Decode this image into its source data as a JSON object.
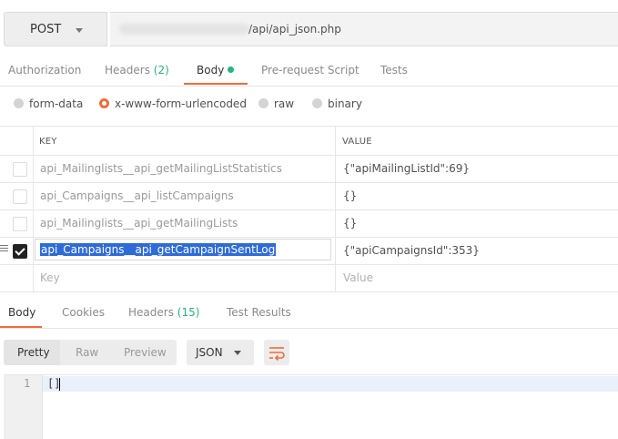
{
  "request": {
    "method": "POST",
    "url_visible": "/api/api_json.php"
  },
  "request_tabs": [
    {
      "label": "Authorization"
    },
    {
      "label": "Headers",
      "count": "(2)"
    },
    {
      "label": "Body",
      "active": true
    },
    {
      "label": "Pre-request Script"
    },
    {
      "label": "Tests"
    }
  ],
  "body_types": [
    {
      "label": "form-data",
      "selected": false
    },
    {
      "label": "x-www-form-urlencoded",
      "selected": true
    },
    {
      "label": "raw",
      "selected": false
    },
    {
      "label": "binary",
      "selected": false
    }
  ],
  "params_table": {
    "headers": {
      "key": "KEY",
      "value": "VALUE"
    },
    "rows": [
      {
        "key": "api_Mailinglists__api_getMailingListStatistics",
        "value": "{\"apiMailingListId\":69}",
        "checked": false
      },
      {
        "key": "api_Campaigns__api_listCampaigns",
        "value": "{}",
        "checked": false
      },
      {
        "key": "api_Mailinglists__api_getMailingLists",
        "value": "{}",
        "checked": false
      },
      {
        "key": "api_Campaigns__api_getCampaignSentLog",
        "value": "{\"apiCampaignsId\":353}",
        "checked": true
      }
    ],
    "new_row": {
      "key_placeholder": "Key",
      "value_placeholder": "Value"
    }
  },
  "response_tabs": [
    {
      "label": "Body",
      "active": true
    },
    {
      "label": "Cookies"
    },
    {
      "label": "Headers",
      "count": "(15)"
    },
    {
      "label": "Test Results"
    }
  ],
  "response_view": {
    "modes": [
      "Pretty",
      "Raw",
      "Preview"
    ],
    "active_mode": "Pretty",
    "format": "JSON"
  },
  "response_body": {
    "line_number": "1",
    "content": "[]"
  },
  "colors": {
    "accent": "#f26b3a",
    "success": "#26b47f",
    "selection": "#2e6bd8"
  }
}
